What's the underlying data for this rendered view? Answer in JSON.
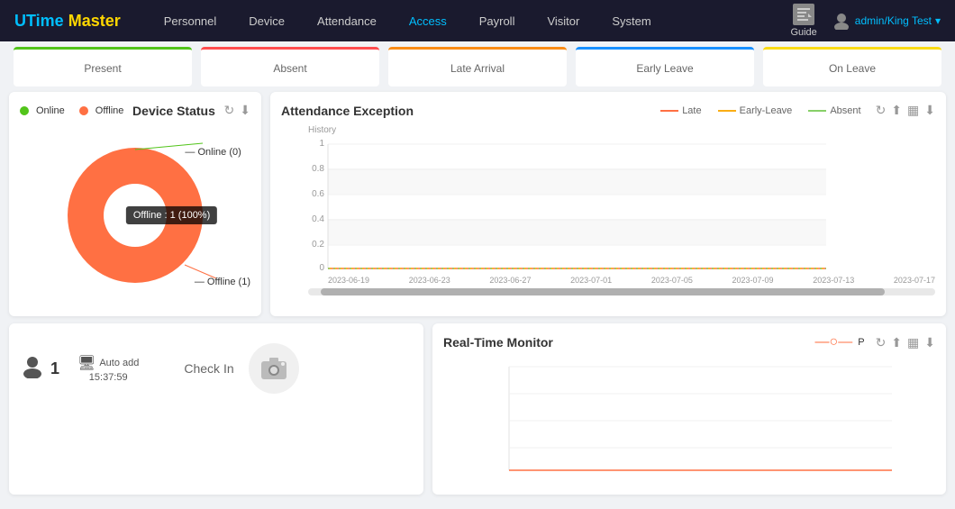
{
  "header": {
    "logo_u": "U",
    "logo_time": "Time",
    "logo_master": "Master",
    "nav_items": [
      "Personnel",
      "Device",
      "Attendance",
      "Access",
      "Payroll",
      "Visitor",
      "System"
    ],
    "active_nav": "Access",
    "guide_label": "Guide",
    "user_label": "admin/King Test"
  },
  "status_cards": [
    {
      "label": "Present",
      "color": "green"
    },
    {
      "label": "Absent",
      "color": "red"
    },
    {
      "label": "Late Arrival",
      "color": "orange"
    },
    {
      "label": "Early Leave",
      "color": "blue"
    },
    {
      "label": "On Leave",
      "color": "yellow"
    }
  ],
  "device_status": {
    "title": "Device Status",
    "legend_online": "Online",
    "legend_offline": "Offline",
    "online_count": 0,
    "offline_count": 1,
    "tooltip": "Offline : 1 (100%)",
    "label_online": "Online (0)",
    "label_offline": "Offline (1)",
    "online_color": "#52c41a",
    "offline_color": "#ff7043"
  },
  "attendance_exception": {
    "title": "Attendance Exception",
    "history_label": "History",
    "legend": [
      {
        "label": "Late",
        "color": "#ff7043"
      },
      {
        "label": "Early-Leave",
        "color": "#faad14"
      },
      {
        "label": "Absent",
        "color": "#87d068"
      }
    ],
    "y_labels": [
      "1",
      "0.8",
      "0.6",
      "0.4",
      "0.2",
      "0"
    ],
    "x_labels": [
      "2023-06-19",
      "2023-06-23",
      "2023-06-27",
      "2023-07-01",
      "2023-07-05",
      "2023-07-09",
      "2023-07-13",
      "2023-07-17"
    ]
  },
  "checkin": {
    "user_count": "1",
    "auto_add_label": "Auto add",
    "time_label": "15:37:59",
    "checkin_label": "Check In"
  },
  "realtime_monitor": {
    "title": "Real-Time Monitor",
    "legend_p": "P",
    "legend_color": "#ff7043"
  },
  "icons": {
    "refresh": "↻",
    "upload": "⬆",
    "bar_chart": "▦",
    "download": "⬇",
    "user": "👤",
    "camera": "📷",
    "screen": "🖥",
    "chevron_down": "▾"
  }
}
